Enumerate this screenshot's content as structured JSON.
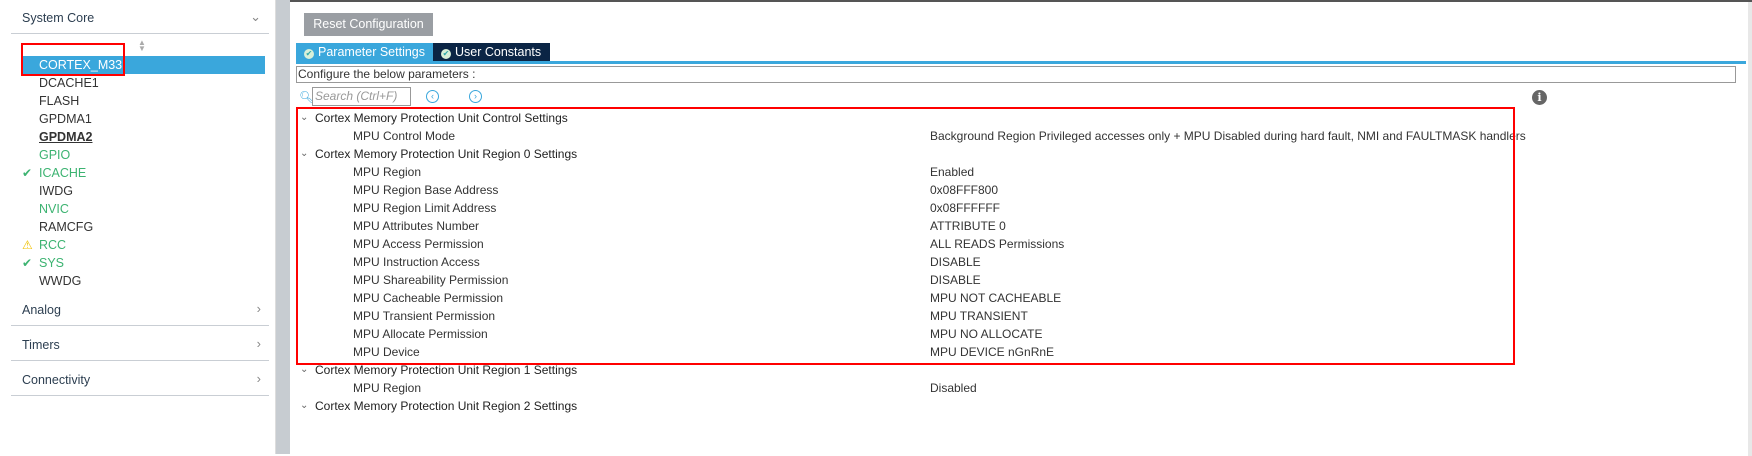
{
  "sidebar": {
    "categories": [
      "System Core",
      "Analog",
      "Timers",
      "Connectivity"
    ],
    "items": [
      {
        "label": "CORTEX_M33",
        "state": "selected"
      },
      {
        "label": "DCACHE1",
        "state": "normal"
      },
      {
        "label": "FLASH",
        "state": "normal"
      },
      {
        "label": "GPDMA1",
        "state": "normal"
      },
      {
        "label": "GPDMA2",
        "state": "bold"
      },
      {
        "label": "GPIO",
        "state": "green"
      },
      {
        "label": "ICACHE",
        "state": "green-check"
      },
      {
        "label": "IWDG",
        "state": "normal"
      },
      {
        "label": "NVIC",
        "state": "green"
      },
      {
        "label": "RAMCFG",
        "state": "normal"
      },
      {
        "label": "RCC",
        "state": "green-warning"
      },
      {
        "label": "SYS",
        "state": "green-check"
      },
      {
        "label": "WWDG",
        "state": "normal"
      }
    ]
  },
  "toolbar": {
    "reset_label": "Reset Configuration"
  },
  "tabs": [
    {
      "label": "Parameter Settings"
    },
    {
      "label": "User Constants"
    }
  ],
  "configure_text": "Configure the below parameters :",
  "search": {
    "placeholder": "Search (Ctrl+F)"
  },
  "params": [
    {
      "type": "group",
      "label": "Cortex Memory Protection Unit Control Settings"
    },
    {
      "type": "param",
      "label": "MPU Control Mode",
      "value": "Background Region Privileged accesses only + MPU Disabled during hard fault, NMI and FAULTMASK handlers"
    },
    {
      "type": "group",
      "label": "Cortex Memory Protection Unit Region 0 Settings"
    },
    {
      "type": "param",
      "label": "MPU Region",
      "value": "Enabled"
    },
    {
      "type": "param",
      "label": "MPU Region Base Address",
      "value": "0x08FFF800"
    },
    {
      "type": "param",
      "label": "MPU Region Limit Address",
      "value": "0x08FFFFFF"
    },
    {
      "type": "param",
      "label": "MPU Attributes Number",
      "value": "ATTRIBUTE 0"
    },
    {
      "type": "param",
      "label": "MPU Access Permission",
      "value": "ALL READS Permissions"
    },
    {
      "type": "param",
      "label": "MPU Instruction Access",
      "value": "DISABLE"
    },
    {
      "type": "param",
      "label": "MPU Shareability Permission",
      "value": "DISABLE"
    },
    {
      "type": "param",
      "label": "MPU Cacheable Permission",
      "value": "MPU NOT CACHEABLE"
    },
    {
      "type": "param",
      "label": "MPU Transient Permission",
      "value": "MPU TRANSIENT"
    },
    {
      "type": "param",
      "label": "MPU Allocate Permission",
      "value": "MPU NO ALLOCATE"
    },
    {
      "type": "param",
      "label": "MPU Device",
      "value": "MPU DEVICE nGnRnE"
    },
    {
      "type": "group",
      "label": "Cortex Memory Protection Unit Region 1 Settings"
    },
    {
      "type": "param",
      "label": "MPU Region",
      "value": "Disabled"
    },
    {
      "type": "group",
      "label": "Cortex Memory Protection Unit Region 2 Settings"
    }
  ]
}
